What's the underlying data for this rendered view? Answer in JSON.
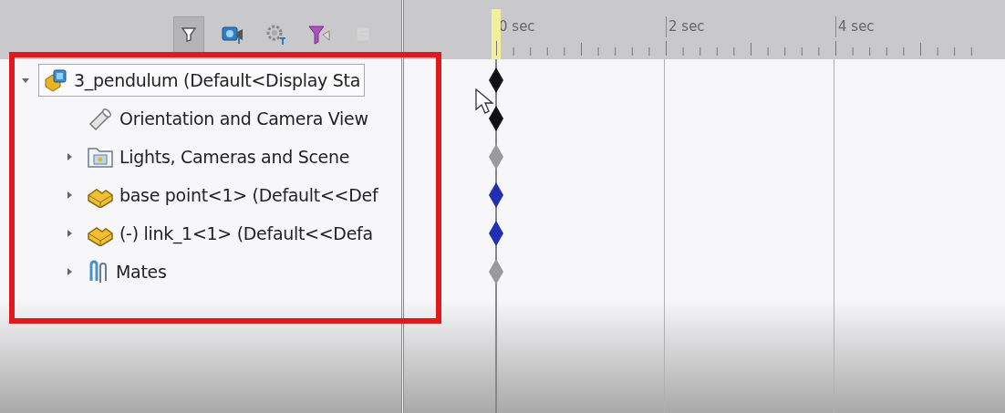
{
  "toolbar": [
    {
      "kind": "filter",
      "selected": true,
      "disabled": false
    },
    {
      "kind": "camera",
      "selected": false,
      "disabled": false
    },
    {
      "kind": "gear",
      "selected": false,
      "disabled": false
    },
    {
      "kind": "funnel",
      "selected": false,
      "disabled": false
    },
    {
      "kind": "sheet",
      "selected": false,
      "disabled": true
    }
  ],
  "ruler": {
    "labels": [
      "0 sec",
      "2 sec",
      "4 sec"
    ]
  },
  "tree": [
    {
      "kind": "assembly",
      "label": "3_pendulum  (Default<Display Sta",
      "expanded": true,
      "selected": true,
      "color": "#111111",
      "children": [
        {
          "kind": "camera",
          "label": "Orientation and Camera View",
          "selected": false,
          "color": "#111111"
        },
        {
          "kind": "lights",
          "label": "Lights, Cameras and Scene",
          "expanded": false,
          "selected": false,
          "color": "#9a9a9a"
        },
        {
          "kind": "part",
          "label": "base point<1> (Default<<Def",
          "expanded": false,
          "selected": false,
          "color": "#1f2fb0"
        },
        {
          "kind": "part",
          "label": "(-) link_1<1> (Default<<Defa",
          "expanded": false,
          "selected": false,
          "color": "#1f2fb0"
        },
        {
          "kind": "mates",
          "label": "Mates",
          "expanded": false,
          "selected": false,
          "color": "#9a9a9a"
        }
      ]
    }
  ]
}
